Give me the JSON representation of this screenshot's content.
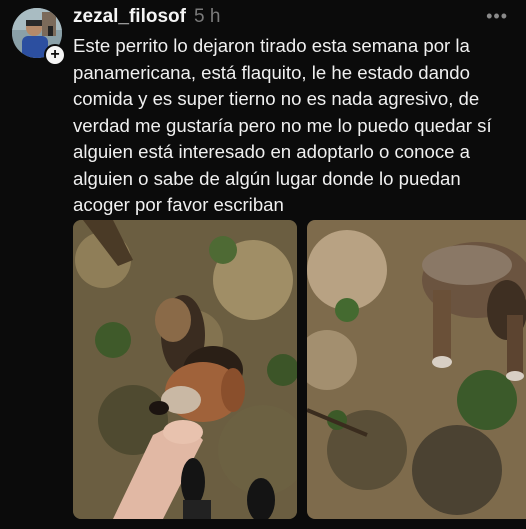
{
  "post": {
    "username": "zezal_filosof",
    "time": "5 h",
    "text": "Este perrito lo dejaron tirado esta semana por la panamericana, está flaquito, le he estado dando comida y es super tierno no es nada agresivo, de verdad me gustaría pero no me lo puedo quedar sí alguien está interesado en adoptarlo o conoce a alguien o sabe de algún lugar donde lo puedan acoger por favor escriban",
    "more_icon": "•••",
    "add_icon": "+"
  },
  "icons": {
    "more": "more-horizontal-icon",
    "add": "plus-icon"
  },
  "colors": {
    "background": "#0b0b0b",
    "text": "#f0f0f0",
    "muted": "#7a7a7a"
  }
}
